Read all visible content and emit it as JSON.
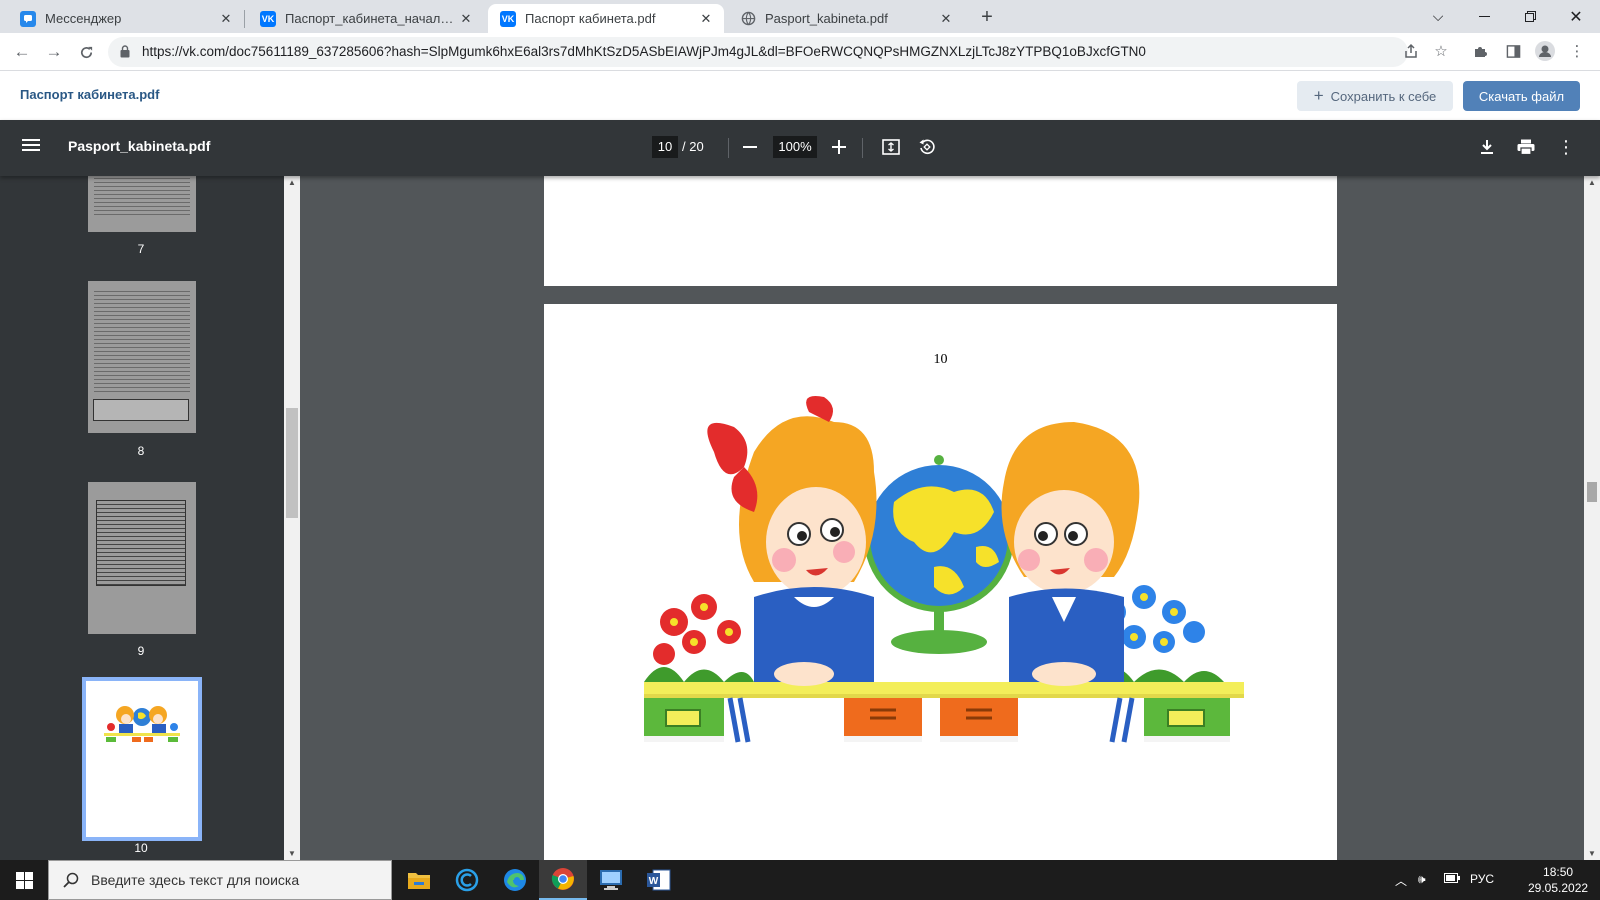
{
  "browser": {
    "tabs": [
      {
        "title": "Мессенджер",
        "active": false
      },
      {
        "title": "Паспорт_кабинета_начальные_",
        "active": false
      },
      {
        "title": "Паспорт кабинета.pdf",
        "active": true
      },
      {
        "title": "Pasport_kabineta.pdf",
        "active": false
      }
    ],
    "url": "https://vk.com/doc75611189_637285606?hash=SlpMgumk6hxE6al3rs7dMhKtSzD5ASbEIAWjPJm4gJL&dl=BFOeRWCQNQPsHMGZNXLzjLTcJ8zYTPBQ1oBJxcfGTN0"
  },
  "vk": {
    "doc_title": "Паспорт кабинета.pdf",
    "save_label": "Сохранить к себе",
    "download_label": "Скачать файл"
  },
  "pdf": {
    "file_name": "Pasport_kabineta.pdf",
    "current_page": "10",
    "total_pages": "/ 20",
    "zoom": "100%",
    "thumbnails": [
      {
        "label": "7"
      },
      {
        "label": "8"
      },
      {
        "label": "9"
      },
      {
        "label": "10"
      }
    ],
    "page_number_text": "10"
  },
  "taskbar": {
    "search_placeholder": "Введите здесь текст для поиска",
    "language": "РУС",
    "time": "18:50",
    "date": "29.05.2022"
  },
  "colors": {
    "vk_blue": "#5181b8",
    "vk_link": "#2a5885",
    "pdf_toolbar": "#323639",
    "viewer_bg": "#525659"
  }
}
